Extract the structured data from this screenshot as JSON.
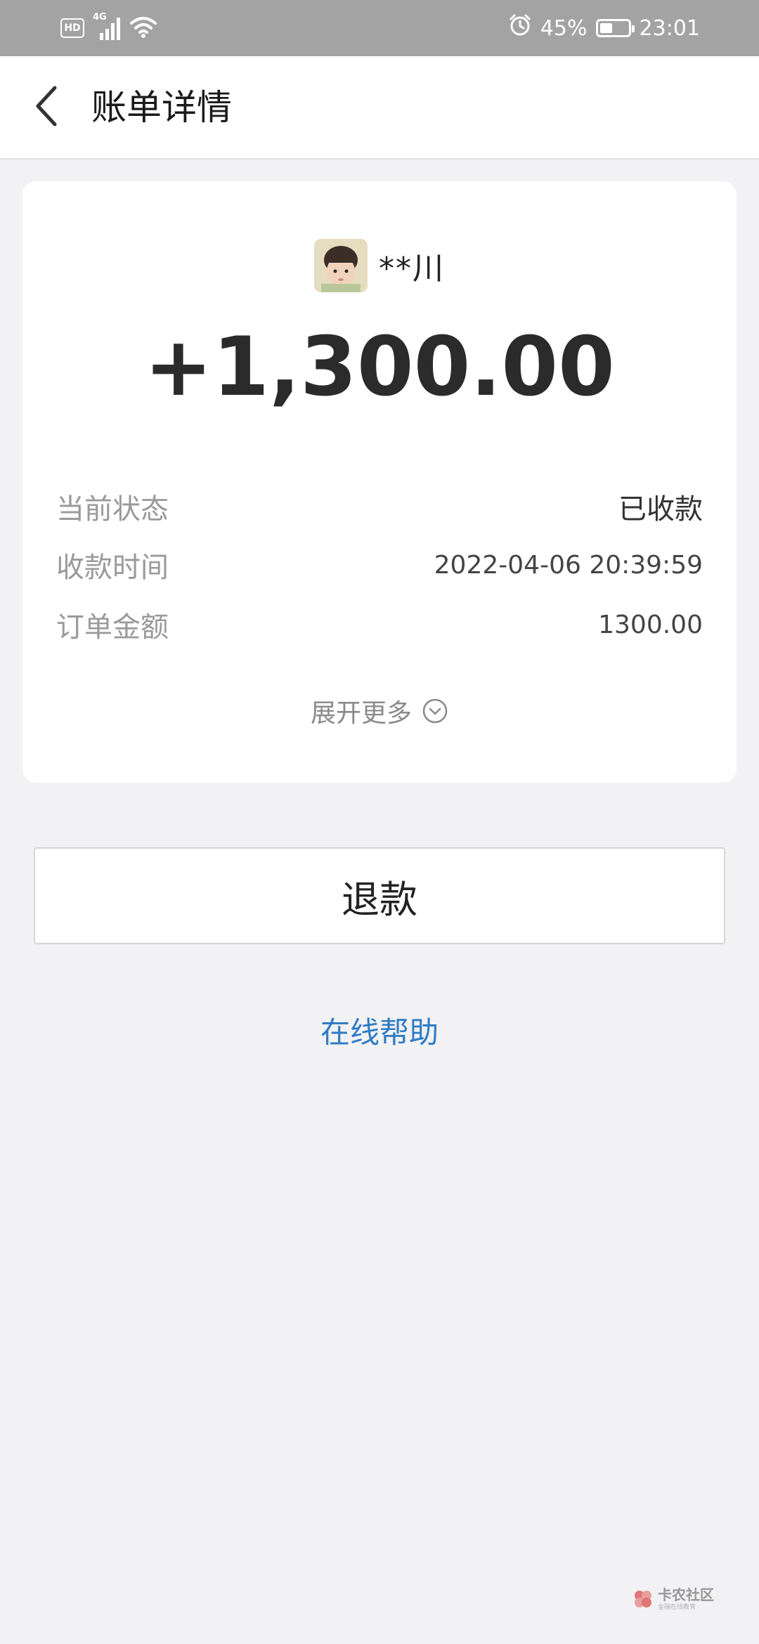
{
  "status_bar": {
    "hd": "HD",
    "network": "4G",
    "battery_percent": "45%",
    "battery_level": 0.45,
    "time": "23:01"
  },
  "header": {
    "back_icon": "chevron-left-icon",
    "title": "账单详情"
  },
  "card": {
    "payer_name": "**川",
    "amount": "+1,300.00",
    "rows": [
      {
        "label": "当前状态",
        "value": "已收款"
      },
      {
        "label": "收款时间",
        "value": "2022-04-06 20:39:59"
      },
      {
        "label": "订单金额",
        "value": "1300.00"
      }
    ],
    "expand_more": "展开更多"
  },
  "refund_button": "退款",
  "help_link": "在线帮助",
  "watermark": {
    "title": "卡农社区",
    "subtitle": "金融在线教育"
  },
  "colors": {
    "status_bar": "#a3a3a3",
    "background": "#f2f2f4",
    "link": "#2e7bc4"
  }
}
